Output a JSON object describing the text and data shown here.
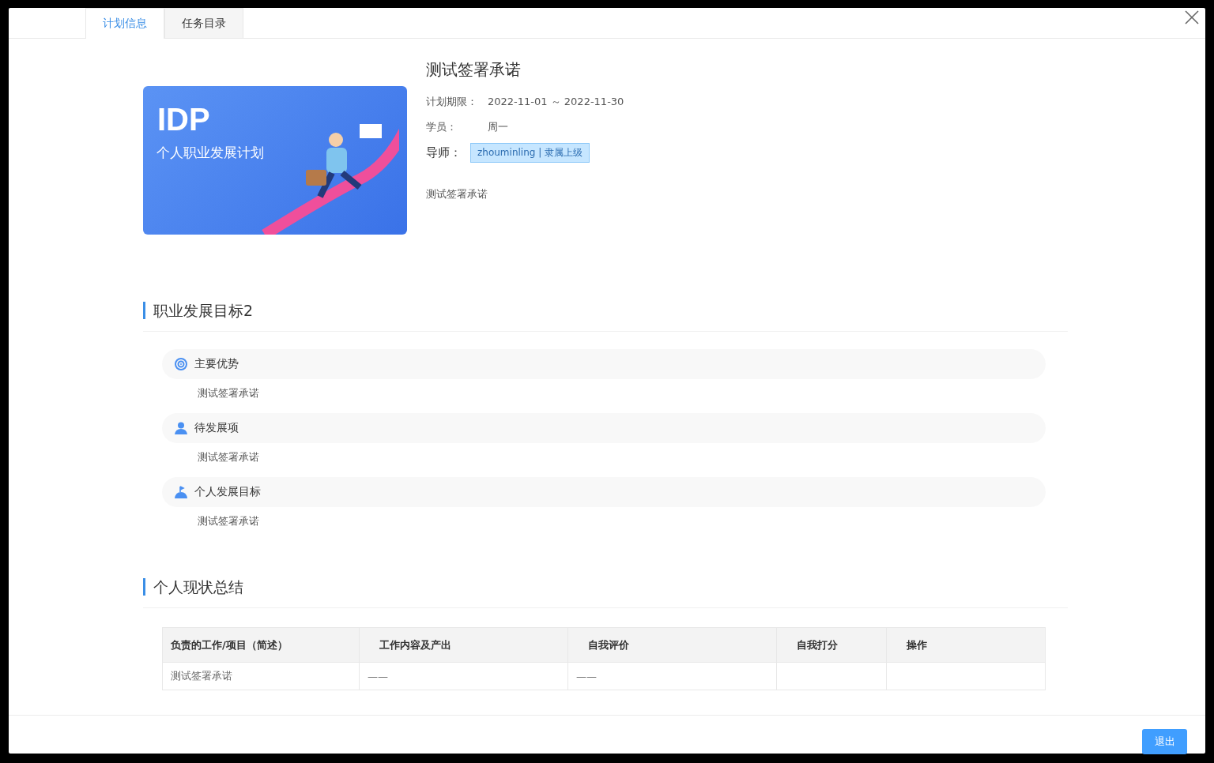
{
  "tabs": [
    {
      "label": "计划信息",
      "selected": true
    },
    {
      "label": "任务目录",
      "selected": false
    }
  ],
  "banner": {
    "title": "IDP",
    "subtitle": "个人职业发展计划"
  },
  "plan": {
    "name": "测试签署承诺",
    "period_label": "计划期限：",
    "period": "2022-11-01 ～ 2022-11-30",
    "student_label": "学员：",
    "student": "周一",
    "mentor_label": "导师：",
    "mentor_tag": "zhouminling | 隶属上级",
    "description": "测试签署承诺"
  },
  "goal_section": {
    "title": "职业发展目标2",
    "items": [
      {
        "kind": "target",
        "label": "主要优势",
        "content": "测试签署承诺"
      },
      {
        "kind": "person",
        "label": "待发展项",
        "content": "测试签署承诺"
      },
      {
        "kind": "flag",
        "label": "个人发展目标",
        "content": "测试签署承诺"
      }
    ]
  },
  "summary_section": {
    "title": "个人现状总结",
    "table": {
      "columns": [
        "负责的工作/项目（简述）",
        "工作内容及产出",
        "自我评价",
        "自我打分",
        "操作"
      ],
      "rows": [
        [
          "测试签署承诺",
          "——",
          "——",
          "",
          ""
        ]
      ]
    }
  },
  "footer": {
    "button": "退出"
  }
}
